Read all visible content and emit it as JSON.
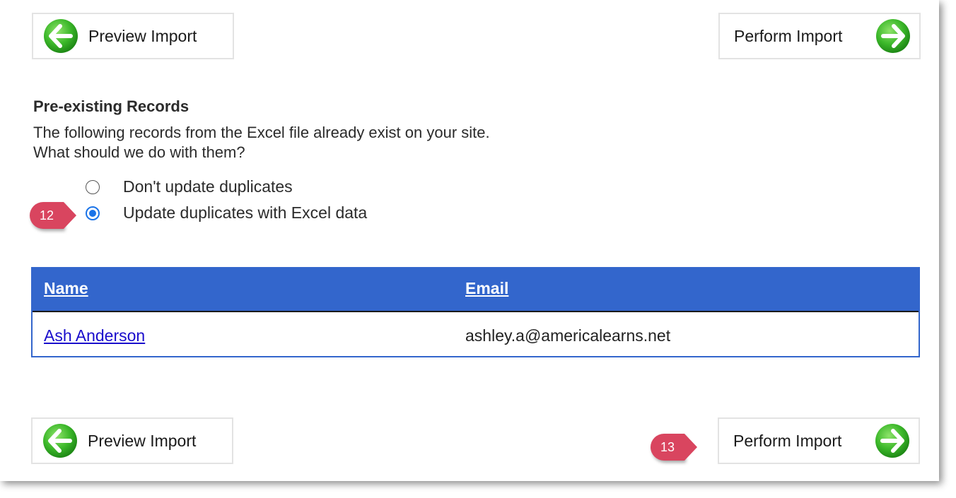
{
  "buttons": {
    "preview_label": "Preview Import",
    "perform_label": "Perform Import"
  },
  "section": {
    "title": "Pre-existing Records",
    "description_line1": "The following records from the Excel file already exist on your site.",
    "description_line2": "What should we do with them?"
  },
  "options": [
    {
      "label": "Don't update duplicates",
      "selected": false
    },
    {
      "label": "Update duplicates with Excel data",
      "selected": true
    }
  ],
  "badges": {
    "step_12": "12",
    "step_13": "13"
  },
  "table": {
    "headers": [
      "Name",
      "Email"
    ],
    "rows": [
      {
        "name": "Ash Anderson",
        "email": "ashley.a@americalearns.net"
      }
    ]
  },
  "colors": {
    "table_header": "#3366cc",
    "badge": "#d9455f",
    "radio_selected": "#1a73e8",
    "arrow_icon": "#3cb82a"
  },
  "icons": {
    "prev": "arrow-left-circle-icon",
    "next": "arrow-right-circle-icon"
  }
}
